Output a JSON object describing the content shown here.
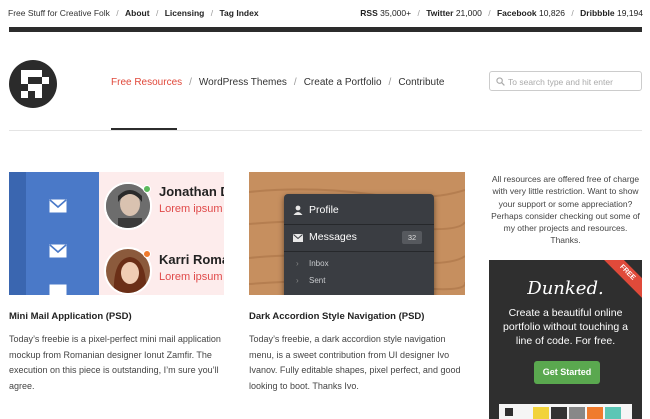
{
  "topbar": {
    "tagline": "Free Stuff for Creative Folk",
    "links": [
      "About",
      "Licensing",
      "Tag Index"
    ],
    "stats": [
      {
        "label": "RSS",
        "value": "35,000+"
      },
      {
        "label": "Twitter",
        "value": "21,000"
      },
      {
        "label": "Facebook",
        "value": "10,826"
      },
      {
        "label": "Dribbble",
        "value": "19,194"
      }
    ]
  },
  "nav": {
    "items": [
      "Free Resources",
      "WordPress Themes",
      "Create a Portfolio",
      "Contribute"
    ],
    "active_index": 0
  },
  "search": {
    "placeholder": "To search type and hit enter",
    "icon": "search-icon"
  },
  "cards": [
    {
      "title": "Mini Mail Application (PSD)",
      "description": "Today’s freebie is a pixel-perfect mini mail application mockup from Romanian designer Ionut Zamfir. The execution on this piece is outstanding, I’m sure you’ll agree.",
      "preview": {
        "contacts": [
          {
            "name": "Jonathan D",
            "subtitle": "Lorem ipsum do",
            "status_color": "#5cb85c"
          },
          {
            "name": "Karri Roman",
            "subtitle": "Lorem ipsum do",
            "status_color": "#f07b2d"
          }
        ]
      }
    },
    {
      "title": "Dark Accordion Style Navigation (PSD)",
      "description": "Today’s freebie, a dark accordion style navigation menu, is a sweet contribution from UI designer Ivo Ivanov. Fully editable shapes, pixel perfect, and good looking to boot. Thanks Ivo.",
      "preview": {
        "rows": [
          {
            "label": "Profile",
            "icon": "user-icon"
          },
          {
            "label": "Messages",
            "icon": "envelope-icon",
            "badge": "32"
          }
        ],
        "subitems": [
          "Inbox",
          "Sent"
        ]
      }
    }
  ],
  "sidebar": {
    "text": "All resources are offered free of charge with very little restriction. Want to show your support or some appreciation? Perhaps consider checking out some of my other projects and resources. Thanks.",
    "ad": {
      "logo": "Dunked.",
      "text": "Create a beautiful online portfolio without touching a line of code. For free.",
      "button": "Get Started",
      "ribbon": "FREE"
    }
  },
  "colors": {
    "accent": "#e0483a",
    "dark": "#2c2c2c",
    "ad_button": "#5aa84f"
  }
}
